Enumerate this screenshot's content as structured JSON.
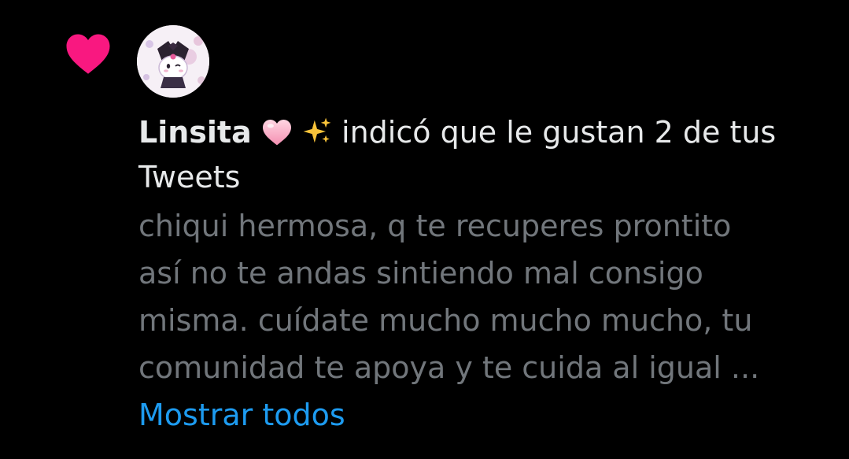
{
  "notification": {
    "icon": "heart-icon",
    "accent_color": "#f91880",
    "avatar": "avatar-kuromi-illustration",
    "username": "Linsita",
    "username_emojis": [
      "pink-heart-emoji",
      "sparkles-emoji"
    ],
    "action_text": "indicó que le gustan 2 de tus Tweets",
    "tweet_text_lines": [
      "chiqui hermosa, q te recuperes prontito",
      "así no te andas sintiendo mal consigo",
      "misma. cuídate mucho mucho mucho, tu",
      "comunidad te apoya y te cuida al igual ..."
    ],
    "show_all_label": "Mostrar todos",
    "link_color": "#1d9bf0"
  }
}
